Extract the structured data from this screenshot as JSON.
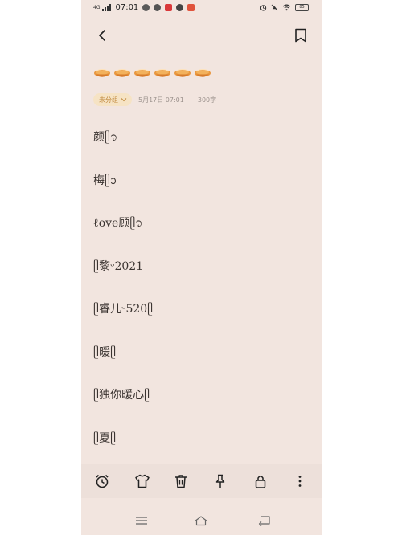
{
  "status_bar": {
    "network": "4G",
    "time": "07:01",
    "battery": "85"
  },
  "note": {
    "title_icon": "orange-bowl-emoji",
    "title_icon_count": 6,
    "group_label": "未分组",
    "date": "5月17日 07:01",
    "char_count": "300字",
    "lines": [
      "颜ᥫ᭡",
      "梅ᥫᩣ",
      "ℓove顾ᥫ᭡",
      "ᥫ黎ᵕ2021",
      "ᥫ睿儿ᵕ520ᥫ",
      "ᥫ暖ᥫ",
      "ᥫ独你暖心ᥫ",
      "ᥫ夏ᥫ"
    ]
  },
  "toolbar": [
    "alarm-clock-icon",
    "shirt-icon",
    "trash-icon",
    "pin-icon",
    "lock-icon",
    "more-vertical-icon"
  ],
  "colors": {
    "background": "#f2e5df",
    "toolbar": "#ede0da",
    "chip_bg": "#f6e3c4",
    "chip_text": "#c0893d"
  }
}
